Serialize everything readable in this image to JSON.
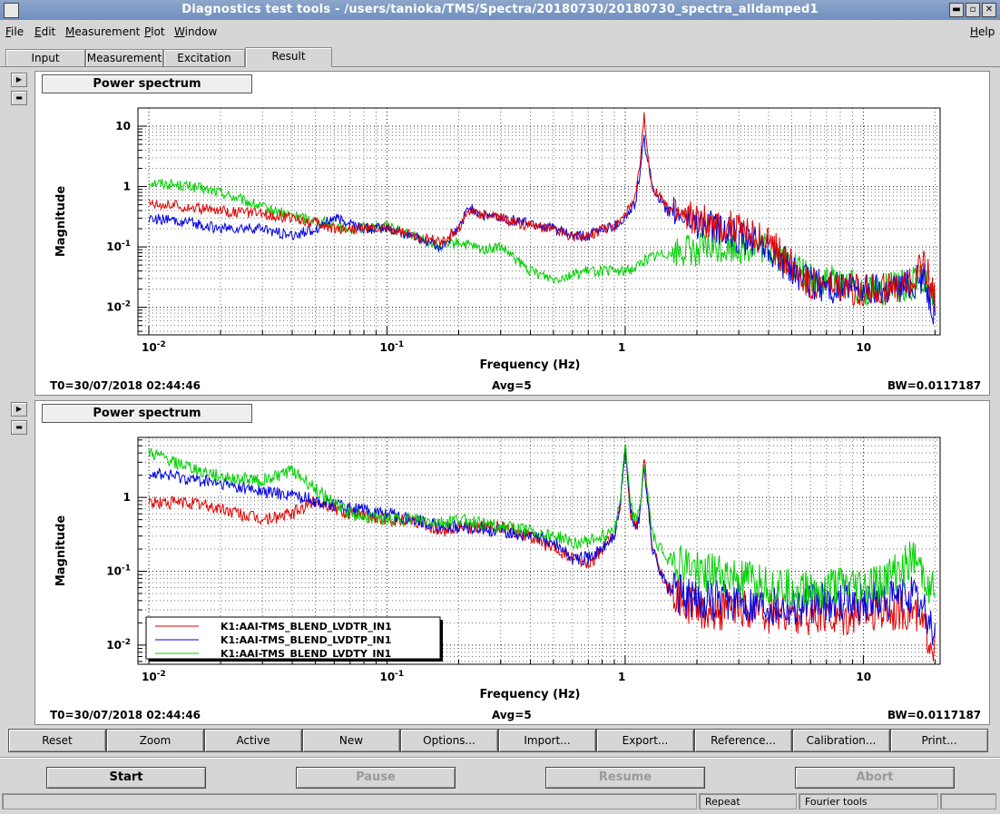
{
  "window": {
    "title": "Diagnostics test tools - /users/tanioka/TMS/Spectra/20180730/20180730_spectra_alldamped1",
    "controls": [
      "▬",
      "▫",
      "✕"
    ]
  },
  "menu": {
    "items": [
      {
        "label": "File",
        "u": "F",
        "rest": "ile"
      },
      {
        "label": "Edit",
        "u": "E",
        "rest": "dit"
      },
      {
        "label": "Measurement",
        "u": "M",
        "rest": "easurement"
      },
      {
        "label": "Plot",
        "u": "P",
        "rest": "lot"
      },
      {
        "label": "Window",
        "u": "W",
        "rest": "indow"
      }
    ],
    "help": {
      "label": "Help",
      "u": "H",
      "rest": "elp"
    }
  },
  "tabs": [
    {
      "label": "Input",
      "active": false
    },
    {
      "label": "Measurement",
      "active": false
    },
    {
      "label": "Excitation",
      "active": false
    },
    {
      "label": "Result",
      "active": true
    }
  ],
  "panels": [
    {
      "title": "Power spectrum",
      "t0": "T0=30/07/2018 02:44:46",
      "avg": "Avg=5",
      "bw": "BW=0.0117187"
    },
    {
      "title": "Power spectrum",
      "t0": "T0=30/07/2018 02:44:46",
      "avg": "Avg=5",
      "bw": "BW=0.0117187"
    }
  ],
  "chart_data": [
    {
      "type": "line",
      "title": "Power spectrum",
      "xlabel": "Frequency (Hz)",
      "ylabel": "Magnitude",
      "xscale": "log",
      "yscale": "log",
      "xlim": [
        0.009,
        21
      ],
      "ylim": [
        0.0035,
        20
      ],
      "xticks": [
        {
          "v": 0.01,
          "label": "10",
          "sup": "-2"
        },
        {
          "v": 0.1,
          "label": "10",
          "sup": "-1"
        },
        {
          "v": 1,
          "label": "1",
          "sup": ""
        },
        {
          "v": 10,
          "label": "10",
          "sup": ""
        }
      ],
      "yticks": [
        {
          "v": 0.01,
          "label": "10",
          "sup": "-2"
        },
        {
          "v": 0.1,
          "label": "10",
          "sup": "-1"
        },
        {
          "v": 1,
          "label": "1",
          "sup": ""
        },
        {
          "v": 10,
          "label": "10",
          "sup": ""
        }
      ],
      "grid": true,
      "series": [
        {
          "color": "#00d000",
          "x": [
            0.01,
            0.015,
            0.02,
            0.03,
            0.04,
            0.05,
            0.07,
            0.1,
            0.13,
            0.17,
            0.2,
            0.25,
            0.3,
            0.35,
            0.4,
            0.5,
            0.6,
            0.7,
            0.8,
            0.9,
            1.0,
            1.1,
            1.2,
            1.3,
            1.5,
            2,
            3,
            4,
            5,
            6,
            8,
            10,
            13,
            16,
            18,
            20
          ],
          "y": [
            1.2,
            1.0,
            0.8,
            0.45,
            0.33,
            0.28,
            0.2,
            0.22,
            0.15,
            0.1,
            0.12,
            0.09,
            0.1,
            0.06,
            0.04,
            0.03,
            0.035,
            0.04,
            0.04,
            0.04,
            0.04,
            0.045,
            0.06,
            0.07,
            0.08,
            0.09,
            0.1,
            0.09,
            0.05,
            0.03,
            0.025,
            0.02,
            0.02,
            0.025,
            0.03,
            0.012
          ]
        },
        {
          "color": "#0000e0",
          "x": [
            0.01,
            0.015,
            0.02,
            0.03,
            0.04,
            0.05,
            0.06,
            0.07,
            0.08,
            0.1,
            0.13,
            0.17,
            0.2,
            0.22,
            0.25,
            0.3,
            0.4,
            0.5,
            0.6,
            0.7,
            0.8,
            0.9,
            1.0,
            1.1,
            1.15,
            1.2,
            1.3,
            1.5,
            2,
            3,
            4,
            5,
            6,
            8,
            10,
            13,
            16,
            18,
            20
          ],
          "y": [
            0.3,
            0.25,
            0.2,
            0.2,
            0.15,
            0.2,
            0.3,
            0.25,
            0.2,
            0.2,
            0.15,
            0.1,
            0.2,
            0.45,
            0.35,
            0.3,
            0.25,
            0.2,
            0.15,
            0.15,
            0.2,
            0.22,
            0.3,
            0.5,
            1.5,
            6,
            1.0,
            0.4,
            0.25,
            0.15,
            0.1,
            0.04,
            0.025,
            0.02,
            0.02,
            0.02,
            0.025,
            0.03,
            0.008
          ]
        },
        {
          "color": "#e00000",
          "x": [
            0.01,
            0.015,
            0.02,
            0.03,
            0.04,
            0.05,
            0.06,
            0.07,
            0.08,
            0.1,
            0.13,
            0.17,
            0.2,
            0.22,
            0.25,
            0.3,
            0.4,
            0.5,
            0.6,
            0.7,
            0.8,
            0.9,
            1.0,
            1.1,
            1.15,
            1.2,
            1.25,
            1.3,
            1.5,
            2,
            3,
            4,
            5,
            6,
            8,
            10,
            13,
            16,
            18,
            20
          ],
          "y": [
            0.55,
            0.45,
            0.4,
            0.35,
            0.3,
            0.25,
            0.2,
            0.2,
            0.2,
            0.2,
            0.15,
            0.12,
            0.2,
            0.4,
            0.35,
            0.3,
            0.22,
            0.2,
            0.15,
            0.15,
            0.2,
            0.22,
            0.35,
            0.6,
            2.0,
            15,
            2.5,
            1.0,
            0.45,
            0.28,
            0.2,
            0.12,
            0.05,
            0.025,
            0.02,
            0.02,
            0.02,
            0.025,
            0.06,
            0.012
          ]
        }
      ]
    },
    {
      "type": "line",
      "title": "Power spectrum",
      "xlabel": "Frequency (Hz)",
      "ylabel": "Magnitude",
      "xscale": "log",
      "yscale": "log",
      "xlim": [
        0.009,
        21
      ],
      "ylim": [
        0.0055,
        6.5
      ],
      "xticks": [
        {
          "v": 0.01,
          "label": "10",
          "sup": "-2"
        },
        {
          "v": 0.1,
          "label": "10",
          "sup": "-1"
        },
        {
          "v": 1,
          "label": "1",
          "sup": ""
        },
        {
          "v": 10,
          "label": "10",
          "sup": ""
        }
      ],
      "yticks": [
        {
          "v": 0.01,
          "label": "10",
          "sup": "-2"
        },
        {
          "v": 0.1,
          "label": "10",
          "sup": "-1"
        },
        {
          "v": 1,
          "label": "1",
          "sup": ""
        }
      ],
      "grid": true,
      "legend_position": "bottom-left",
      "series": [
        {
          "name": "K1:AAI-TMS_BLEND_LVDTR_IN1",
          "color": "#e00000",
          "x": [
            0.01,
            0.015,
            0.02,
            0.03,
            0.04,
            0.05,
            0.07,
            0.1,
            0.13,
            0.17,
            0.2,
            0.3,
            0.4,
            0.5,
            0.6,
            0.7,
            0.8,
            0.9,
            0.95,
            1.0,
            1.05,
            1.1,
            1.15,
            1.2,
            1.3,
            1.5,
            2,
            3,
            5,
            8,
            10,
            13,
            16,
            20
          ],
          "y": [
            0.85,
            0.85,
            0.7,
            0.5,
            0.6,
            0.9,
            0.6,
            0.5,
            0.5,
            0.35,
            0.4,
            0.4,
            0.3,
            0.2,
            0.15,
            0.12,
            0.2,
            0.3,
            0.8,
            4.5,
            0.6,
            0.4,
            0.5,
            3.5,
            0.2,
            0.06,
            0.03,
            0.03,
            0.025,
            0.025,
            0.03,
            0.03,
            0.03,
            0.01
          ]
        },
        {
          "name": "K1:AAI-TMS_BLEND_LVDTP_IN1",
          "color": "#0000e0",
          "x": [
            0.01,
            0.015,
            0.02,
            0.03,
            0.04,
            0.05,
            0.07,
            0.1,
            0.13,
            0.17,
            0.2,
            0.3,
            0.4,
            0.5,
            0.6,
            0.7,
            0.8,
            0.9,
            0.95,
            1.0,
            1.05,
            1.1,
            1.15,
            1.2,
            1.3,
            1.5,
            2,
            3,
            5,
            8,
            10,
            13,
            16,
            20
          ],
          "y": [
            2.2,
            1.8,
            1.5,
            1.2,
            1.1,
            0.9,
            0.7,
            0.6,
            0.5,
            0.4,
            0.4,
            0.35,
            0.3,
            0.25,
            0.15,
            0.15,
            0.2,
            0.3,
            0.7,
            5.0,
            0.7,
            0.4,
            0.5,
            3.0,
            0.2,
            0.06,
            0.04,
            0.04,
            0.035,
            0.04,
            0.04,
            0.04,
            0.05,
            0.015
          ]
        },
        {
          "name": "K1:AAI-TMS_BLEND_LVDTY_IN1",
          "color": "#00d000",
          "x": [
            0.01,
            0.015,
            0.02,
            0.03,
            0.04,
            0.05,
            0.07,
            0.1,
            0.13,
            0.17,
            0.2,
            0.3,
            0.4,
            0.5,
            0.6,
            0.7,
            0.8,
            0.9,
            0.95,
            1.0,
            1.05,
            1.1,
            1.15,
            1.2,
            1.3,
            1.5,
            2,
            3,
            5,
            8,
            10,
            13,
            16,
            20
          ],
          "y": [
            4.0,
            2.5,
            1.9,
            1.7,
            2.3,
            1.3,
            0.6,
            0.5,
            0.5,
            0.45,
            0.5,
            0.4,
            0.35,
            0.3,
            0.25,
            0.25,
            0.3,
            0.4,
            0.8,
            5.5,
            0.8,
            0.5,
            0.6,
            3.0,
            0.3,
            0.15,
            0.1,
            0.08,
            0.06,
            0.06,
            0.06,
            0.08,
            0.15,
            0.05
          ]
        }
      ]
    }
  ],
  "toolbar": [
    "Reset",
    "Zoom",
    "Active",
    "New",
    "Options...",
    "Import...",
    "Export...",
    "Reference...",
    "Calibration...",
    "Print..."
  ],
  "controls": [
    {
      "label": "Start",
      "enabled": true
    },
    {
      "label": "Pause",
      "enabled": false
    },
    {
      "label": "Resume",
      "enabled": false
    },
    {
      "label": "Abort",
      "enabled": false
    }
  ],
  "status": {
    "repeat": "Repeat",
    "tools": "Fourier tools"
  }
}
